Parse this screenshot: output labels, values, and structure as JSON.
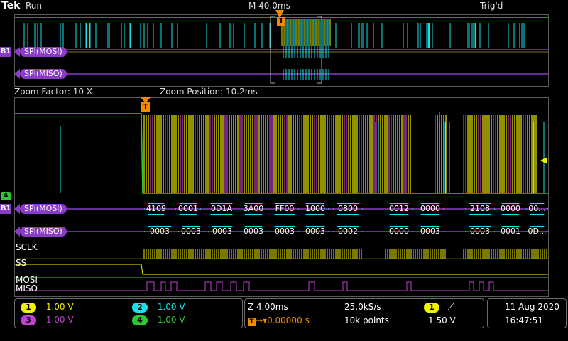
{
  "header": {
    "brand": "Tek",
    "acq_state": "Run",
    "timebase": "M 40.0ms",
    "trigger_status": "Trig'd"
  },
  "overview": {
    "bus1_label": "SPI(MOSI)",
    "bus2_label": "SPI(MISO)",
    "bus_badge": "B1",
    "trigger_marker": "T"
  },
  "zoom": {
    "factor": "Zoom Factor: 10 X",
    "position": "Zoom Position: 10.2ms",
    "trigger_marker": "T",
    "ch4_tag": "4",
    "bus_badge": "B1",
    "mosi_label": "SPI(MOSI)",
    "miso_label": "SPI(MISO)",
    "sclk_label": "SCLK",
    "ss_label": "SS",
    "mosi_digital_label": "MOSI",
    "miso_digital_label": "MISO",
    "mosi_packets": [
      "4109",
      "0001",
      "0D1A",
      "3A00",
      "FF00",
      "1000",
      "0800",
      "0012",
      "0000",
      "2108",
      "0000",
      "00..."
    ],
    "miso_packets": [
      "0003",
      "0003",
      "0003",
      "0003",
      "0003",
      "0003",
      "0002",
      "0000",
      "0003",
      "0003",
      "0001",
      "0D..."
    ]
  },
  "channels": [
    {
      "num": "1",
      "scale": "1.00 V",
      "color": "#f2f200"
    },
    {
      "num": "2",
      "scale": "1.00 V",
      "color": "#19e0e8"
    },
    {
      "num": "3",
      "scale": "1.00 V",
      "color": "#c040d0"
    },
    {
      "num": "4",
      "scale": "1.00 V",
      "color": "#2ec82e"
    }
  ],
  "acquisition": {
    "zoom_scale": "Z 4.00ms",
    "sample_rate": "25.0kS/s",
    "record_length": "10k points",
    "trigger_delay": "0.00000 s",
    "trigger_source": "1",
    "trigger_slope_icon": "rising-edge-icon",
    "trigger_level": "1.50 V"
  },
  "datetime": {
    "date": "11 Aug 2020",
    "time": "16:47:51"
  },
  "colors": {
    "ch1": "#f2f200",
    "ch2": "#19e0e8",
    "ch3": "#c040d0",
    "ch4": "#2ec82e",
    "bus": "#8a3bc8",
    "trigger": "#f28a00",
    "grid": "#5a5a5a"
  }
}
